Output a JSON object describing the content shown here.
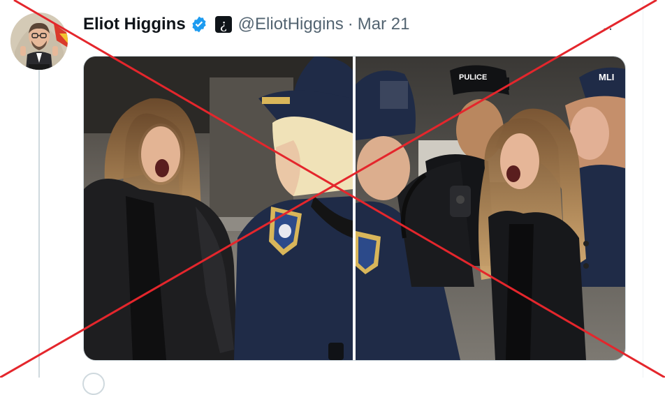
{
  "tweet": {
    "author_name": "Eliot Higgins",
    "handle": "@EliotHiggins",
    "separator": "·",
    "date": "Mar 21",
    "affiliation_badge": "¿",
    "more_label": "··",
    "media": [
      {
        "subject": "woman-shouting-at-police-officer"
      },
      {
        "subject": "woman-shouting-among-police"
      }
    ]
  },
  "right_panel_cap_text": [
    "PULICE",
    "MLI"
  ],
  "overlay": {
    "type": "red-x",
    "color": "#e4262c"
  },
  "colors": {
    "verified": "#1d9bf0",
    "text_primary": "#0f1419",
    "text_secondary": "#536471",
    "border": "#cfd9de",
    "navy_uniform": "#1f2b47"
  }
}
